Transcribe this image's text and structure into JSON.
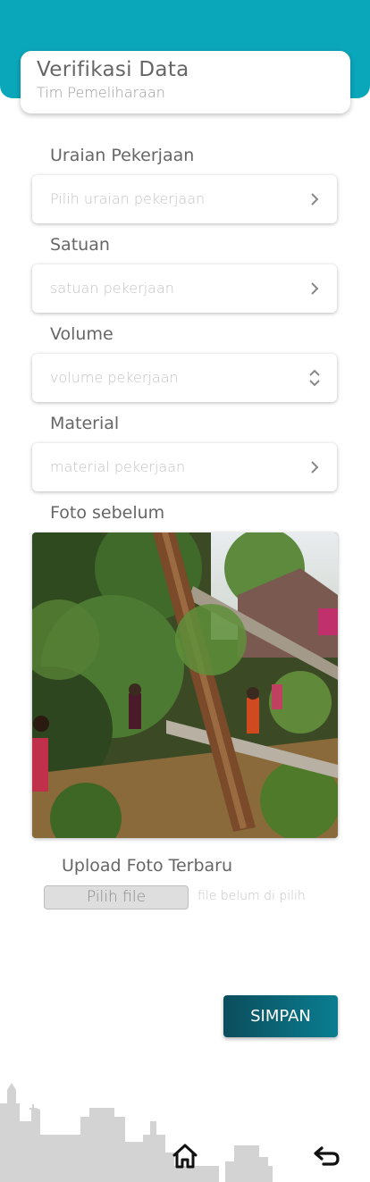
{
  "header": {
    "title": "Verifikasi Data",
    "subtitle": "Tim Pemeliharaan",
    "bg_color": "#0aa7ba"
  },
  "form": {
    "uraian": {
      "label": "Uraian Pekerjaan",
      "placeholder": "Pilih uraian pekerjaan",
      "icon": "chevron-right-icon"
    },
    "satuan": {
      "label": "Satuan",
      "placeholder": "satuan pekerjaan",
      "icon": "chevron-right-icon"
    },
    "volume": {
      "label": "Volume",
      "placeholder": "volume pekerjaan",
      "icon": "up-down-stepper-icon"
    },
    "material": {
      "label": "Material",
      "placeholder": "material pekerjaan",
      "icon": "chevron-right-icon"
    },
    "foto_sebelum": {
      "label": "Foto sebelum"
    },
    "upload": {
      "label": "Upload Foto Terbaru",
      "button": "Pilih file",
      "status": "file belum di pilih"
    }
  },
  "actions": {
    "save_label": "SIMPAN",
    "save_color": "#0b5d6e"
  },
  "bottom_nav": {
    "home_icon": "home-icon",
    "back_icon": "return-arrow-icon"
  }
}
